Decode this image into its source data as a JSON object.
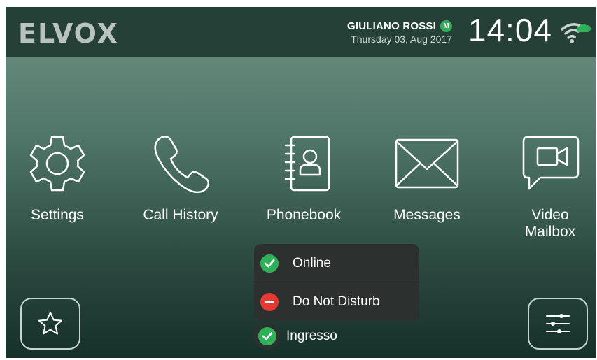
{
  "brand": "ELVOX",
  "header": {
    "user_name": "GIULIANO ROSSI",
    "mode_badge": "M",
    "date": "Thursday 03, Aug 2017",
    "time": "14:04",
    "wifi_icon": "wifi-cloud-icon",
    "cloud_color": "#2fb15a"
  },
  "tiles": [
    {
      "label": "Settings",
      "icon": "gear-icon"
    },
    {
      "label": "Call History",
      "icon": "phone-handset-icon"
    },
    {
      "label": "Phonebook",
      "icon": "contact-book-icon"
    },
    {
      "label": "Messages",
      "icon": "envelope-icon"
    },
    {
      "label_line1": "Video",
      "label_line2": "Mailbox",
      "icon": "video-speech-bubble-icon"
    }
  ],
  "status_menu": {
    "items": [
      {
        "label": "Online",
        "icon": "check-circle-icon",
        "color": "#2fb15a"
      },
      {
        "label": "Do Not Disturb",
        "icon": "minus-circle-icon",
        "color": "#e53935"
      }
    ]
  },
  "footer": {
    "status_label": "Ingresso",
    "status_icon": "check-circle-icon",
    "favorites_icon": "star-icon",
    "settings_icon": "sliders-icon"
  },
  "colors": {
    "topbar": "#254137",
    "online": "#2fb15a",
    "dnd": "#e53935"
  }
}
